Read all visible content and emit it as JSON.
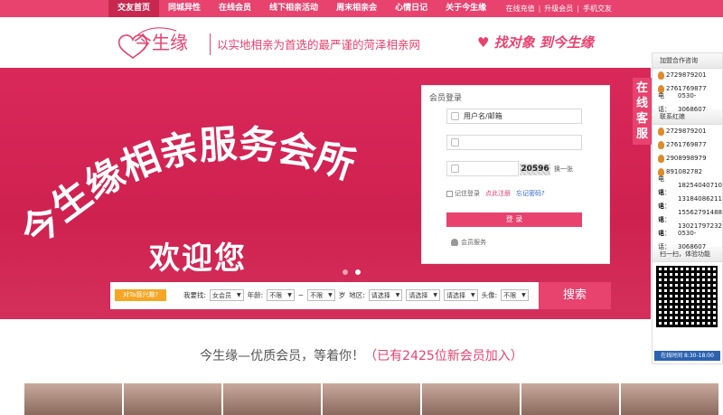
{
  "nav": {
    "items": [
      "交友首页",
      "同城异性",
      "在线会员",
      "线下相亲活动",
      "周末相亲会",
      "心情日记",
      "关于今生缘"
    ],
    "active_index": 0,
    "right_links": [
      "在线充值",
      "升级会员",
      "手机交友"
    ]
  },
  "header": {
    "logo_text": "今生缘",
    "tagline": "以实地相亲为首选的最严谨的菏泽相亲网",
    "slogan": "找对象 到今生缘"
  },
  "banner": {
    "title": "今生缘相亲服务会所",
    "welcome": "欢迎您",
    "dots": 2,
    "active_dot": 1
  },
  "login": {
    "title": "会员登录",
    "username_placeholder": "用户名/邮箱",
    "captcha_text": "20596",
    "refresh_label": "换一张",
    "remember_label": "记住登录",
    "register_label": "点此注册",
    "forgot_label": "忘记密码?",
    "submit_label": "登 录",
    "service_label": "会员服务"
  },
  "search": {
    "bubble": "对Ta感兴趣?",
    "find_label": "我要找:",
    "gender_value": "女会员",
    "age_label": "年龄:",
    "age_from": "不限",
    "age_to": "不限",
    "sep": "~",
    "age_unit": "岁",
    "region_label": "地区:",
    "region1": "请选择",
    "region2": "请选择",
    "region3": "请选择",
    "photo_label": "头像:",
    "photo_value": "不限",
    "button": "搜索"
  },
  "right_panel": {
    "consult_header": "加盟合作咨询",
    "consult_qq": [
      "2729879201",
      "2761769877"
    ],
    "phone_prefix": "电话：",
    "consult_phone": "0530-3068607",
    "matchmaker_header": "联系红娘",
    "matchmaker_qq": [
      "2729879201",
      "2761769877",
      "2908998979",
      "891082782"
    ],
    "matchmaker_phones": [
      "18254040710",
      "13184086211",
      "15562791488",
      "13021797232",
      "0530-3068607"
    ],
    "scan_label": "扫一扫，体验功能",
    "hours": "在线时间 8:30-18:00",
    "cs_tab": "在线客服"
  },
  "section": {
    "invite_text": "今生缘—优质会员，等着你！",
    "invite_count": "（已有2425位新会员加入）"
  },
  "colors": {
    "brand": "#e8426f",
    "nav_active": "#c8284f",
    "bubble": "#f5a623"
  }
}
